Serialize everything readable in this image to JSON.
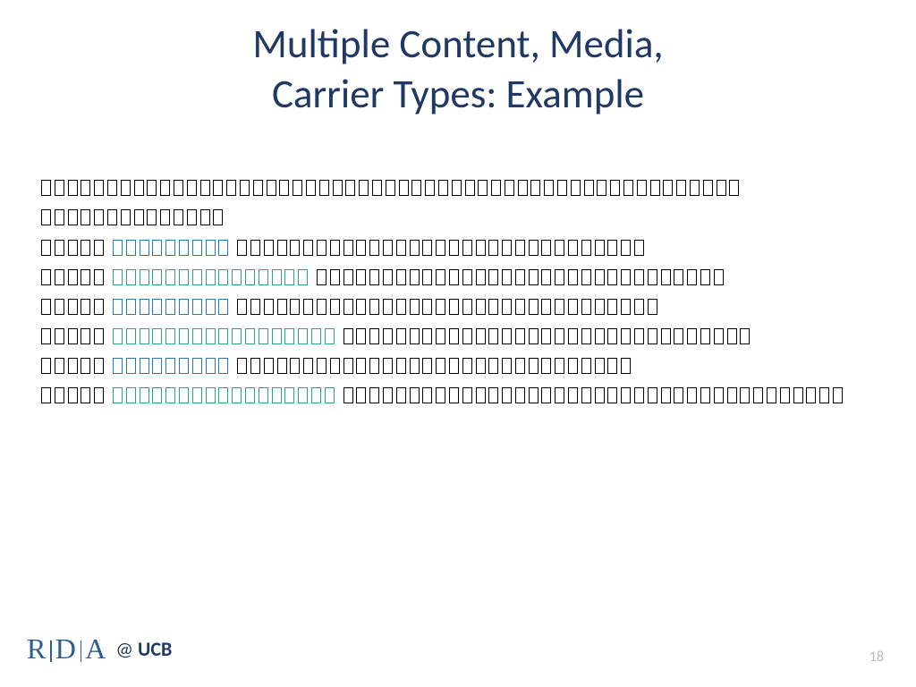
{
  "title_line1": "Multiple Content, Media,",
  "title_line2": "Carrier Types: Example",
  "lines": [
    {
      "segments": [
        {
          "n": 53,
          "c": "k"
        }
      ]
    },
    {
      "segments": [
        {
          "n": 14,
          "c": "k"
        }
      ]
    },
    {
      "segments": [
        {
          "n": 5,
          "c": "k"
        },
        {
          "gap": true
        },
        {
          "n": 9,
          "c": "b"
        },
        {
          "gap": true
        },
        {
          "n": 31,
          "c": "k"
        }
      ]
    },
    {
      "segments": [
        {
          "n": 5,
          "c": "k"
        },
        {
          "gap": true
        },
        {
          "n": 15,
          "c": "g"
        },
        {
          "gap": true
        },
        {
          "n": 31,
          "c": "k"
        }
      ]
    },
    {
      "segments": [
        {
          "n": 5,
          "c": "k"
        },
        {
          "gap": true
        },
        {
          "n": 9,
          "c": "b"
        },
        {
          "gap": true
        },
        {
          "n": 32,
          "c": "k"
        }
      ]
    },
    {
      "segments": [
        {
          "n": 5,
          "c": "k"
        },
        {
          "gap": true
        },
        {
          "n": 17,
          "c": "g"
        },
        {
          "gap": true
        },
        {
          "n": 31,
          "c": "k"
        }
      ]
    },
    {
      "segments": [
        {
          "n": 5,
          "c": "k"
        },
        {
          "gap": true
        },
        {
          "n": 9,
          "c": "b"
        },
        {
          "gap": true
        },
        {
          "n": 30,
          "c": "k"
        }
      ]
    },
    {
      "segments": [
        {
          "n": 5,
          "c": "k"
        },
        {
          "gap": true
        },
        {
          "n": 17,
          "c": "g"
        },
        {
          "gap": true
        },
        {
          "n": 38,
          "c": "k"
        }
      ]
    }
  ],
  "footer": {
    "logo_r": "R",
    "logo_d": "D",
    "logo_a": "A",
    "at": "@",
    "ucb": "UCB"
  },
  "page_number": "18"
}
